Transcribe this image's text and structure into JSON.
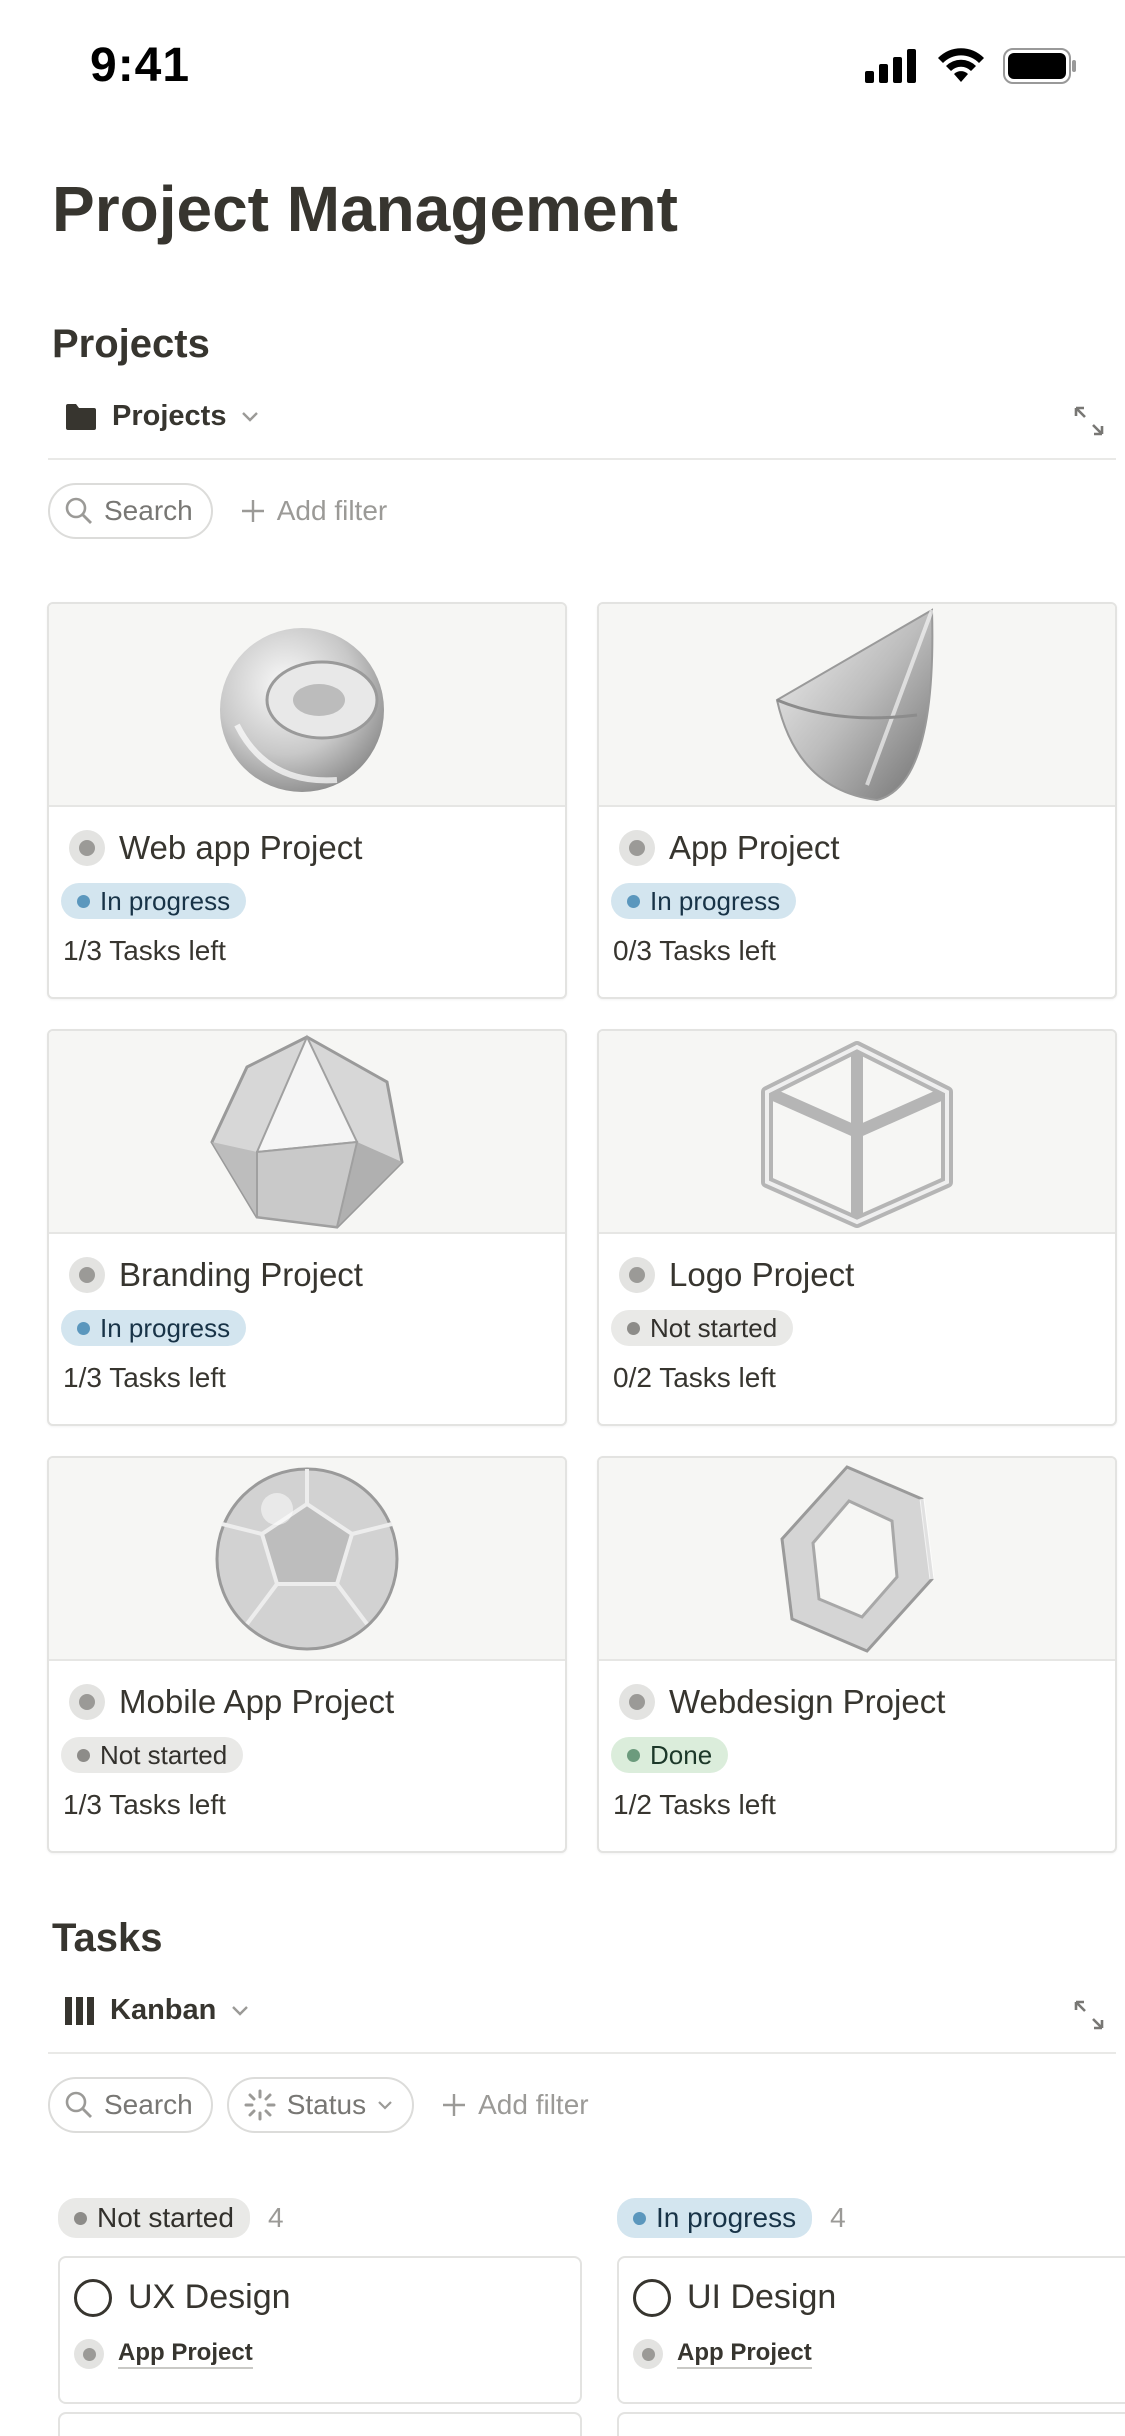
{
  "status_bar": {
    "time": "9:41"
  },
  "page_title": "Project Management",
  "projects_section": {
    "title": "Projects",
    "view_label": "Projects",
    "search_label": "Search",
    "add_filter_label": "Add filter",
    "cards": [
      {
        "title": "Web app Project",
        "status": "In progress",
        "tasks_left": "1/3 Tasks left"
      },
      {
        "title": "App Project",
        "status": "In progress",
        "tasks_left": "0/3 Tasks left"
      },
      {
        "title": "Branding Project",
        "status": "In progress",
        "tasks_left": "1/3 Tasks left"
      },
      {
        "title": "Logo Project",
        "status": "Not started",
        "tasks_left": "0/2 Tasks left"
      },
      {
        "title": "Mobile App Project",
        "status": "Not started",
        "tasks_left": "1/3 Tasks left"
      },
      {
        "title": "Webdesign Project",
        "status": "Done",
        "tasks_left": "1/2 Tasks left"
      }
    ]
  },
  "tasks_section": {
    "title": "Tasks",
    "view_label": "Kanban",
    "search_label": "Search",
    "status_filter_label": "Status",
    "add_filter_label": "Add filter",
    "columns": [
      {
        "label": "Not started",
        "count": "4",
        "cards": [
          {
            "title": "UX Design",
            "project": "App Project"
          }
        ]
      },
      {
        "label": "In progress",
        "count": "4",
        "cards": [
          {
            "title": "UI Design",
            "project": "App Project"
          }
        ]
      }
    ]
  },
  "colors": {
    "text": "#37352f",
    "in_progress_bg": "#d3e5ef",
    "in_progress_dot": "#5b97bd",
    "in_progress_text": "#183347",
    "not_started_bg": "#e9e9e7",
    "not_started_dot": "#8d8c89",
    "not_started_text": "#32302c",
    "done_bg": "#dbeddb",
    "done_dot": "#6c9b7d",
    "done_text": "#1c3829"
  }
}
